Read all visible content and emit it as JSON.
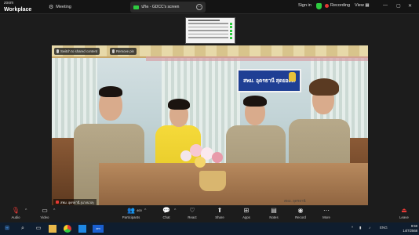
{
  "app": {
    "brand_top": "zoom",
    "brand_bottom": "Workplace"
  },
  "titlebar": {
    "meeting_label": "Meeting",
    "share_tab_label": "ปกิด - GDCC's screen",
    "signin_label": "Sign in",
    "recording_label": "Recording",
    "view_label": "View"
  },
  "video": {
    "switch_button_label": "Switch to shared content",
    "remove_pin_label": "Remove pin",
    "participant_name": "สพม. อุดรธานี (นางนวล)",
    "sign_text": "สพม. อุดรธานี สุดยอดดี",
    "watermark": "สพม. อุดรธานี"
  },
  "toolbar": {
    "audio": "Audio",
    "video": "Video",
    "participants": "Participants",
    "participants_count": "400",
    "chat": "Chat",
    "react": "React",
    "share": "Share",
    "apps": "Apps",
    "notes": "Notes",
    "record": "Record",
    "more": "More",
    "leave": "Leave"
  },
  "taskbar": {
    "lang": "ENG",
    "time": "9:59",
    "date": "14/7/2568"
  },
  "colors": {
    "recording_red": "#e53935",
    "shield_green": "#2ecc40",
    "sign_blue": "#1f3f94",
    "taskbar_bg": "#0f1d2e"
  },
  "icons": [
    "search-icon",
    "windows-start-icon",
    "task-view-icon",
    "file-explorer-icon",
    "chrome-icon",
    "store-icon",
    "zoom-icon"
  ]
}
